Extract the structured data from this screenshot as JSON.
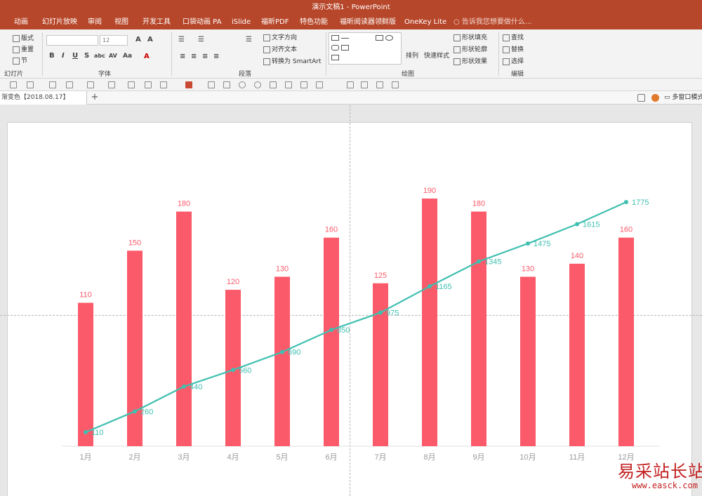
{
  "window": {
    "title": "演示文稿1 - PowerPoint"
  },
  "ribbon_tabs": [
    "动画",
    "幻灯片放映",
    "审阅",
    "视图",
    "开发工具",
    "口袋动画 PA",
    "iSlide",
    "福昕PDF",
    "特色功能",
    "福昕阅读器领鲜版",
    "OneKey Lite"
  ],
  "tell_me": "告诉我您想要做什么...",
  "ribbon": {
    "slides": {
      "layout": "版式",
      "reset": "重置",
      "section": "节",
      "label": "幻灯片"
    },
    "font": {
      "size": "12",
      "label": "字体"
    },
    "paragraph": {
      "text_direction": "文字方向",
      "align_text": "对齐文本",
      "convert_smartart": "转换为 SmartArt",
      "label": "段落"
    },
    "drawing": {
      "arrange": "排列",
      "quick_styles": "快速样式",
      "shape_fill": "形状填充",
      "shape_outline": "形状轮廓",
      "shape_effects": "形状效果",
      "label": "绘图"
    },
    "editing": {
      "find": "查找",
      "replace": "替换",
      "select": "选择",
      "label": "编辑"
    }
  },
  "doc_tab": "渐变色【2018.08.17】",
  "window_mode": "多窗口模式",
  "watermark": {
    "text": "易采站长站",
    "url": "www.easck.com"
  },
  "colors": {
    "bar": "#fb5a6a",
    "line": "#3fbfb0",
    "axis_text": "#9a9a9a"
  },
  "chart_data": {
    "type": "bar+line",
    "categories": [
      "1月",
      "2月",
      "3月",
      "4月",
      "5月",
      "6月",
      "7月",
      "8月",
      "9月",
      "10月",
      "11月",
      "12月"
    ],
    "series": [
      {
        "type": "bar",
        "values": [
          110,
          150,
          180,
          120,
          130,
          160,
          125,
          190,
          180,
          130,
          140,
          160
        ]
      },
      {
        "type": "line",
        "values": [
          110,
          260,
          440,
          560,
          690,
          850,
          975,
          1165,
          1345,
          1475,
          1615,
          1775
        ]
      }
    ],
    "bar_axis_range": [
      0,
      200
    ],
    "line_axis_range": [
      0,
      2000
    ],
    "grid": false,
    "legend": "none"
  }
}
